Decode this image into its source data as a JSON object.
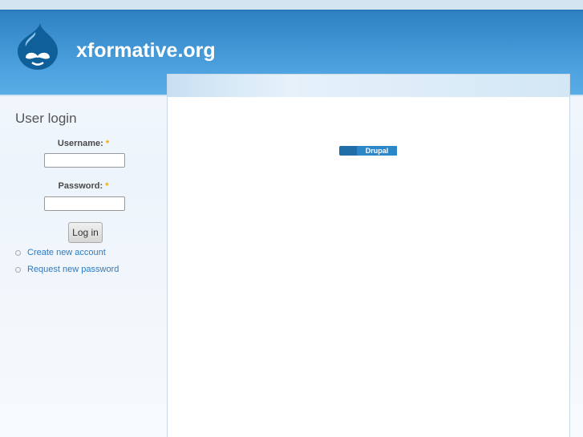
{
  "site": {
    "name": "xformative.org"
  },
  "login": {
    "title": "User login",
    "username_label": "Username:",
    "password_label": "Password:",
    "required_mark": "*",
    "submit_label": "Log in",
    "links": [
      "Create new account",
      "Request new password"
    ]
  },
  "footer": {
    "powered_by": "Drupal"
  },
  "colors": {
    "header": "#2e82c3",
    "link": "#2a7bc4"
  }
}
